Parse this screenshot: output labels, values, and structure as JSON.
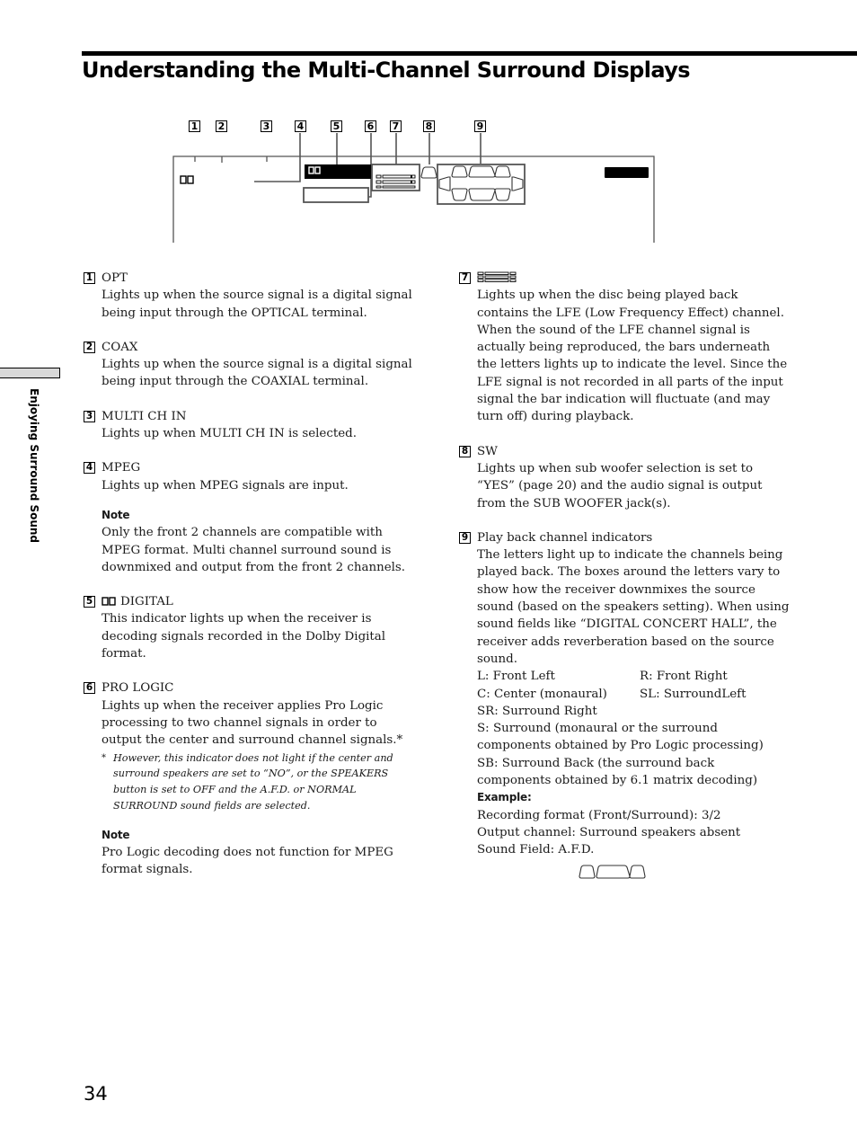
{
  "page": {
    "title": "Understanding the Multi-Channel Surround Displays",
    "side_section": "Enjoying Surround Sound",
    "page_number": "34"
  },
  "diagram": {
    "callouts": [
      "1",
      "2",
      "3",
      "4",
      "5",
      "6",
      "7",
      "8",
      "9"
    ],
    "dolby_icon": "dolby-double-d-icon",
    "lfe_icon": "lfe-level-bars-icon",
    "speaker_icon": "speaker-channel-layout-icon"
  },
  "items": [
    {
      "num": "1",
      "head": "OPT",
      "text": "Lights up when the source signal is a digital signal being input through the OPTICAL terminal."
    },
    {
      "num": "2",
      "head": "COAX",
      "text": "Lights up when the source signal is a digital signal being input through the COAXIAL terminal."
    },
    {
      "num": "3",
      "head": "MULTI CH IN",
      "text": "Lights up when MULTI CH IN is selected."
    },
    {
      "num": "4",
      "head": "MPEG",
      "text": "Lights up when MPEG signals are input.",
      "note_head": "Note",
      "note": "Only the front 2 channels are compatible with MPEG format. Multi channel surround sound is downmixed and output from the front 2 channels."
    },
    {
      "num": "5",
      "head": "DIGITAL",
      "head_icon": "dolby-double-d-icon",
      "text": "This indicator lights up when the receiver is decoding signals recorded in the Dolby Digital format."
    },
    {
      "num": "6",
      "head": "PRO LOGIC",
      "text": "Lights up when the receiver applies Pro Logic processing to two channel signals in order to output the center and surround channel signals.*",
      "footnote_mark": "*",
      "footnote": "However, this indicator does not light if the center and surround speakers are set to “NO”, or the SPEAKERS button is set to OFF and the A.F.D. or NORMAL SURROUND sound fields are selected.",
      "note_head": "Note",
      "note": "Pro Logic decoding does not function for MPEG format signals."
    },
    {
      "num": "7",
      "head_icon": "lfe-level-bars-icon",
      "text": "Lights up when the disc being played back contains the LFE (Low Frequency Effect) channel. When the sound of the LFE channel signal is actually being reproduced, the bars underneath the letters lights up to indicate the level. Since the LFE signal is not recorded in all parts of the input signal the bar indication will fluctuate (and may turn off) during playback."
    },
    {
      "num": "8",
      "head": "SW",
      "text": "Lights up when sub woofer selection is set to “YES” (page 20) and the audio signal is output from the SUB WOOFER jack(s)."
    },
    {
      "num": "9",
      "head": "Play back channel indicators",
      "text": "The letters light up to indicate the channels being played back. The boxes around the letters vary to show how the receiver downmixes the source sound (based on the speakers setting). When using sound fields like “DIGITAL CONCERT HALL”, the receiver adds reverberation based on the source sound.",
      "legend": [
        [
          "L: Front Left",
          "R: Front Right"
        ],
        [
          "C: Center (monaural)",
          "SL: SurroundLeft"
        ]
      ],
      "legend_lines": [
        "SR: Surround Right",
        "S: Surround (monaural or the surround components obtained by Pro Logic processing)",
        "SB: Surround Back (the surround back components obtained by 6.1 matrix decoding)"
      ],
      "example_head": "Example:",
      "example_lines": [
        "Recording format (Front/Surround): 3/2",
        "Output channel: Surround speakers absent",
        "Sound Field: A.F.D."
      ],
      "example_icon": "front-three-speaker-boxes-icon"
    }
  ]
}
